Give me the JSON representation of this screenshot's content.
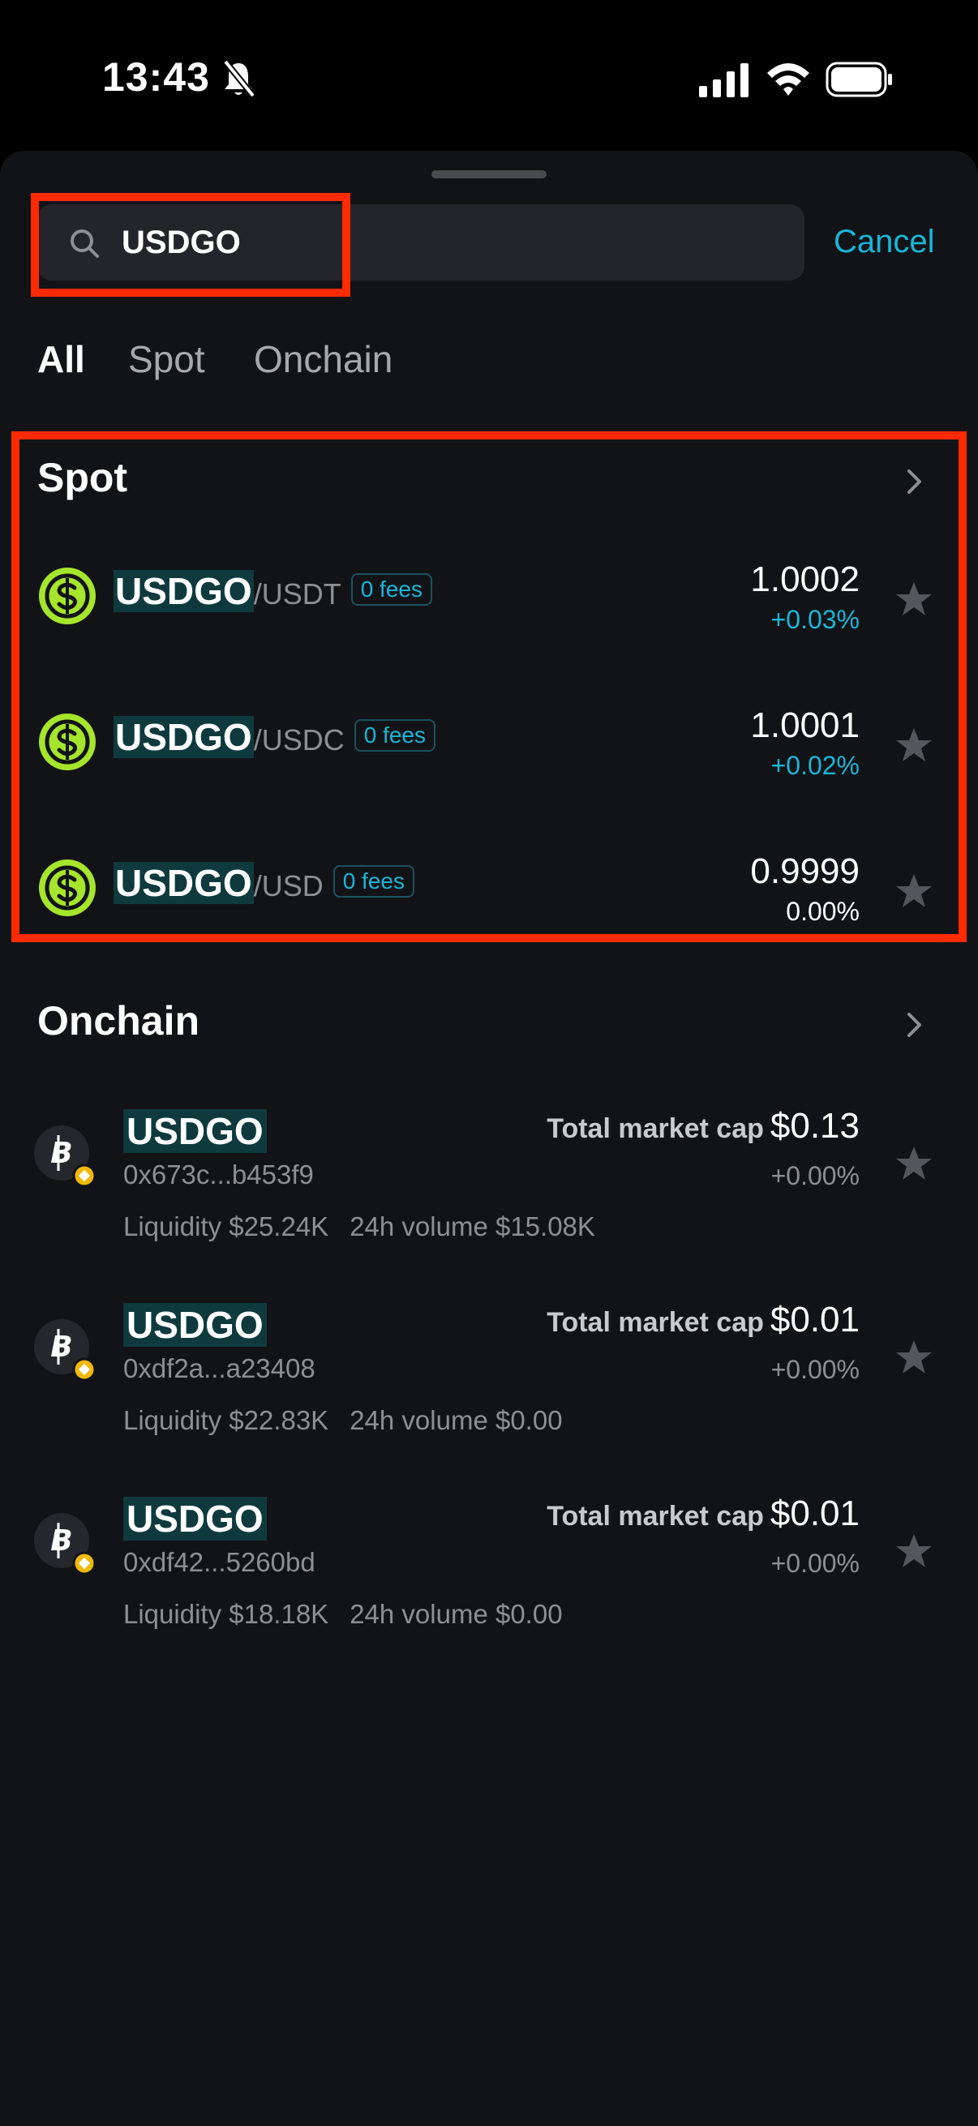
{
  "status": {
    "time": "13:43"
  },
  "search": {
    "value": "USDGO",
    "cancel_label": "Cancel"
  },
  "tabs": [
    {
      "label": "All",
      "active": true
    },
    {
      "label": "Spot",
      "active": false
    },
    {
      "label": "Onchain",
      "active": false
    }
  ],
  "spot": {
    "title": "Spot",
    "items": [
      {
        "base": "USDGO",
        "quote": "/USDT",
        "fees": "0 fees",
        "price": "1.0002",
        "change": "+0.03%"
      },
      {
        "base": "USDGO",
        "quote": "/USDC",
        "fees": "0 fees",
        "price": "1.0001",
        "change": "+0.02%"
      },
      {
        "base": "USDGO",
        "quote": "/USD",
        "fees": "0 fees",
        "price": "0.9999",
        "change": "0.00%"
      }
    ]
  },
  "onchain": {
    "title": "Onchain",
    "items": [
      {
        "name": "USDGO",
        "address": "0x673c...b453f9",
        "mcap_label": "Total market cap",
        "mcap": "$0.13",
        "change": "+0.00%",
        "liquidity": "Liquidity $25.24K",
        "volume": "24h volume $15.08K"
      },
      {
        "name": "USDGO",
        "address": "0xdf2a...a23408",
        "mcap_label": "Total market cap",
        "mcap": "$0.01",
        "change": "+0.00%",
        "liquidity": "Liquidity $22.83K",
        "volume": "24h volume $0.00"
      },
      {
        "name": "USDGO",
        "address": "0xdf42...5260bd",
        "mcap_label": "Total market cap",
        "mcap": "$0.01",
        "change": "+0.00%",
        "liquidity": "Liquidity $18.18K",
        "volume": "24h volume $0.00"
      }
    ]
  },
  "colors": {
    "accent": "#19b6d6",
    "highlight": "#ff2a00",
    "background": "#121317",
    "coin_green": "#a5e52b"
  }
}
